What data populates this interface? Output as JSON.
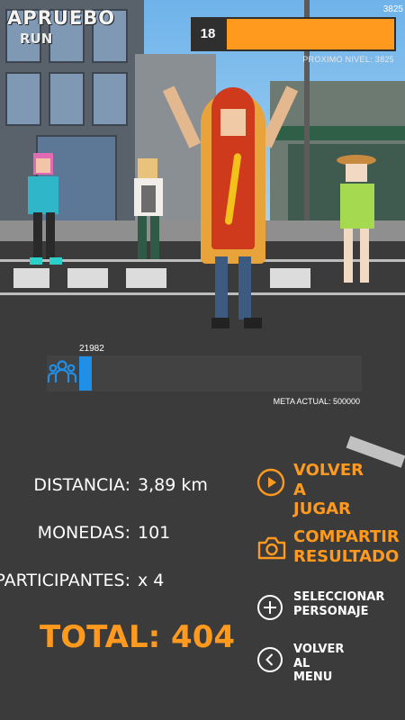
{
  "logo": {
    "title": "APRUEBO",
    "subtitle": "RUN"
  },
  "level": {
    "current": "18",
    "max_value": "3825",
    "next_level_label": "PROXIMO NIVEL: 3825",
    "progress": 1.0,
    "color": "#ff9a1f"
  },
  "goal": {
    "current_value": "21982",
    "target_label": "META ACTUAL: 500000",
    "progress": 0.044,
    "icon": "group-people-icon",
    "color": "#1f8fe8"
  },
  "stats": {
    "distance_label": "DISTANCIA:",
    "distance_value": "3,89 km",
    "coins_label": "MONEDAS:",
    "coins_value": "101",
    "participants_label": "PARTICIPANTES:",
    "participants_value": "x 4",
    "total_label": "TOTAL: 404"
  },
  "menu": {
    "play_again_line1": "VOLVER A",
    "play_again_line2": "JUGAR",
    "share_line1": "COMPARTIR",
    "share_line2": "RESULTADO",
    "select_line1": "SELECCIONAR",
    "select_line2": "PERSONAJE",
    "back_line1": "VOLVER AL",
    "back_line2": "MENU"
  },
  "icons": {
    "play": "play-circle-icon",
    "share": "camera-icon",
    "select": "plus-circle-icon",
    "back": "chevron-left-circle-icon"
  },
  "colors": {
    "accent": "#ff9a1f",
    "blue": "#1f8fe8"
  }
}
